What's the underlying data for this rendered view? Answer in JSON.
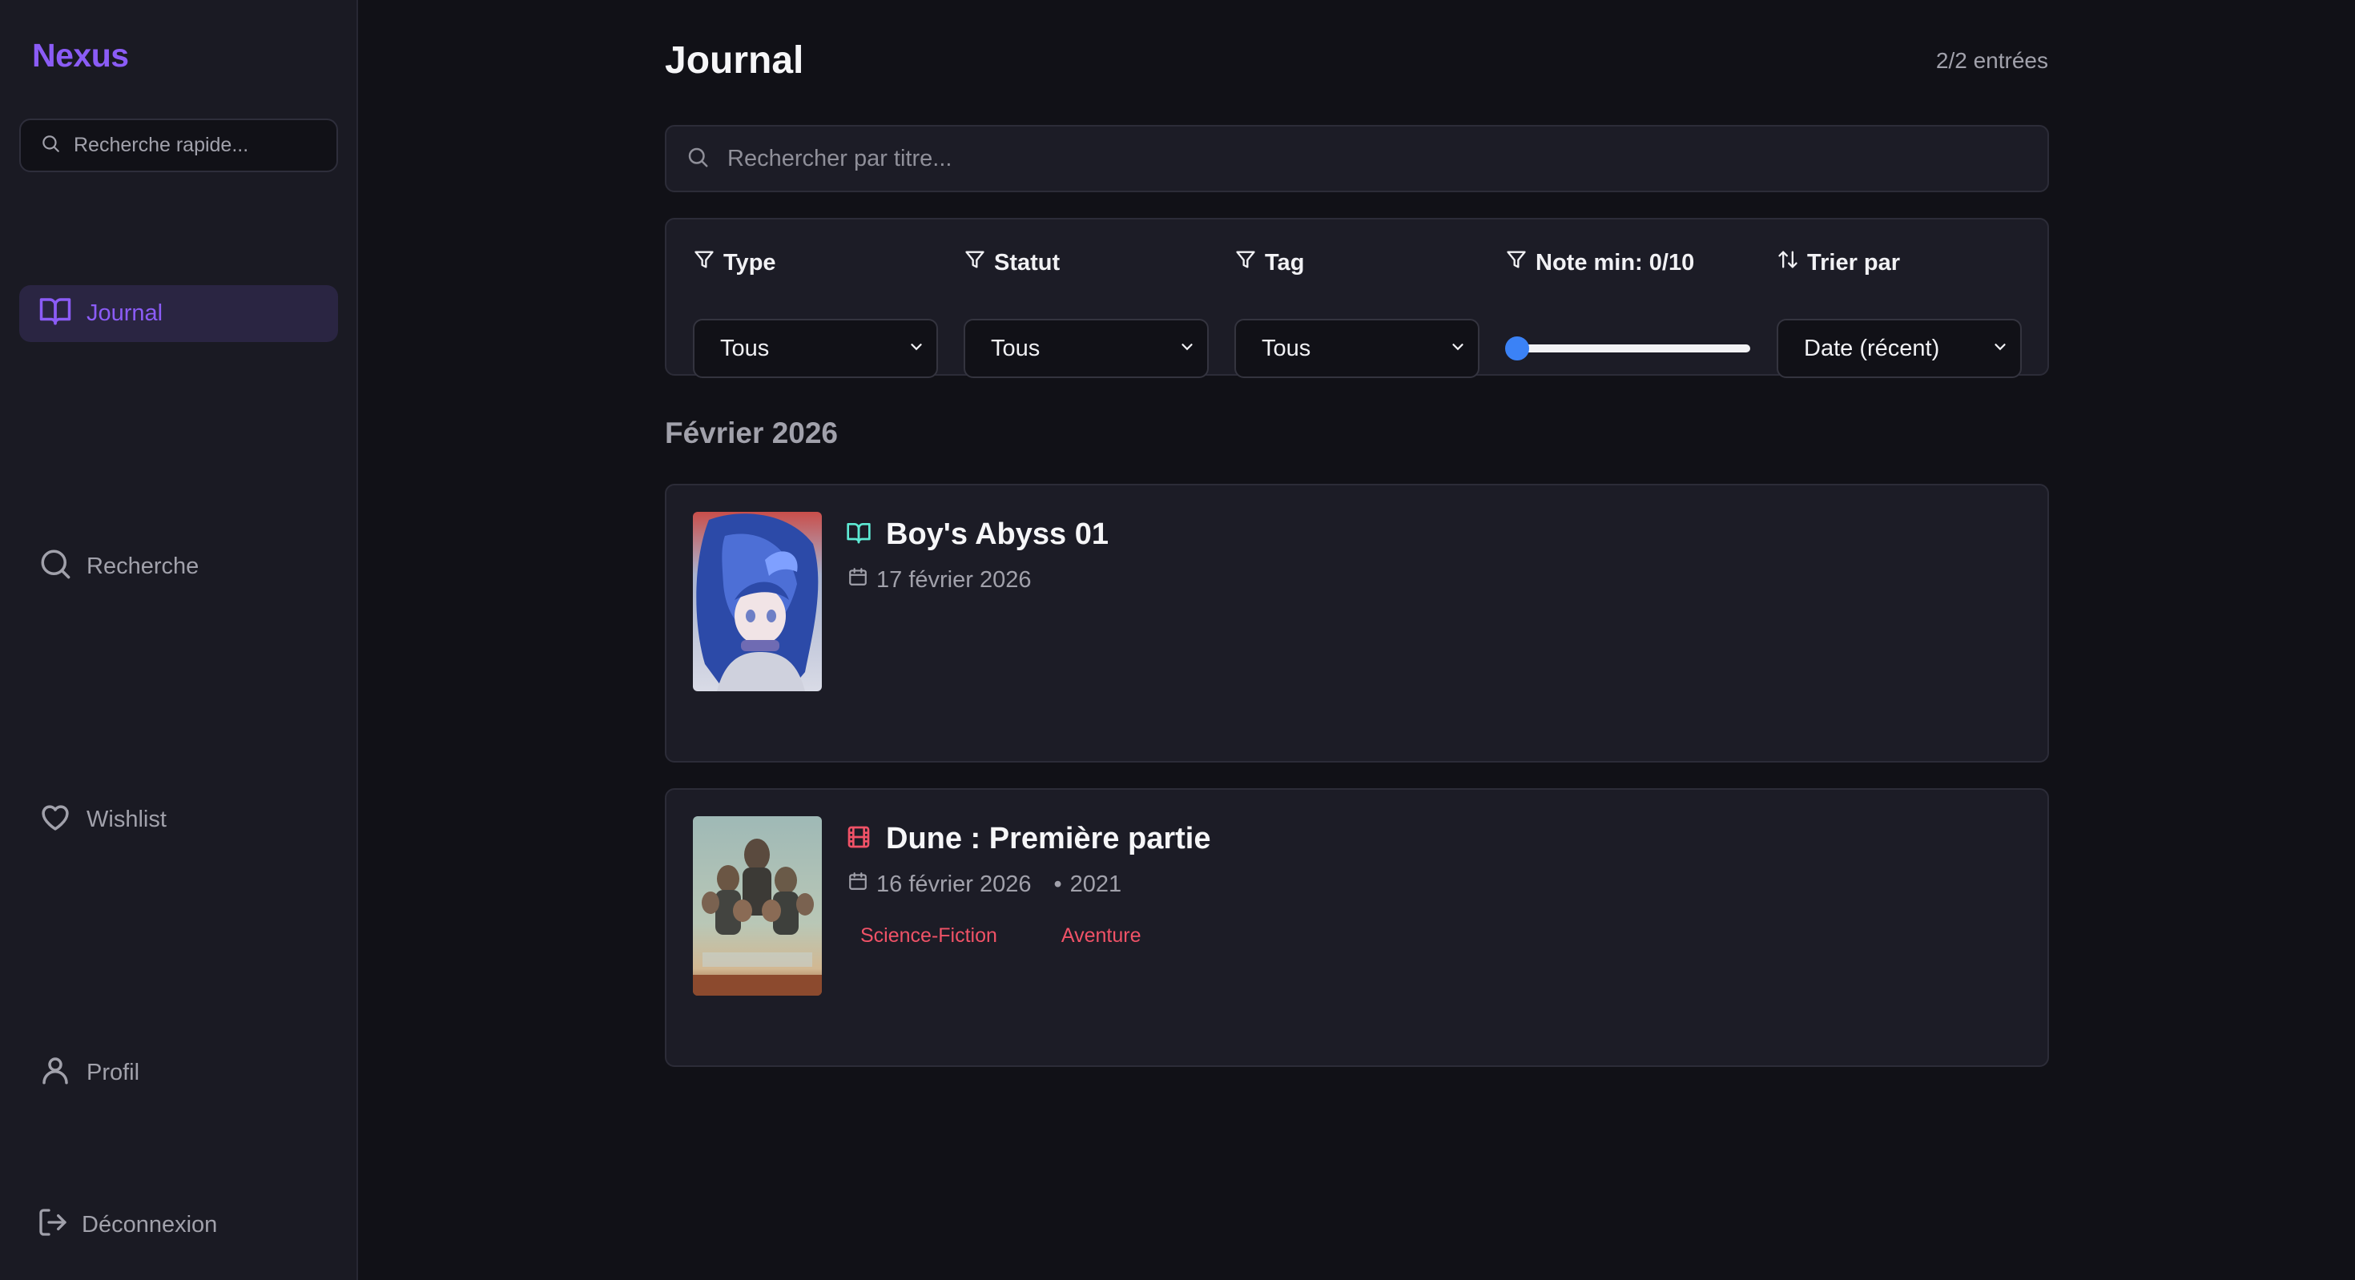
{
  "sidebar": {
    "brand": "Nexus",
    "quick_search_placeholder": "Recherche rapide...",
    "items": [
      {
        "label": "Journal",
        "icon": "book-open-icon",
        "active": true
      },
      {
        "label": "Recherche",
        "icon": "search-icon"
      },
      {
        "label": "Wishlist",
        "icon": "heart-icon"
      },
      {
        "label": "Profil",
        "icon": "user-icon"
      }
    ],
    "logout_label": "Déconnexion"
  },
  "main": {
    "title": "Journal",
    "count": "2/2 entrées",
    "search_placeholder": "Rechercher par titre..."
  },
  "filters": {
    "type": {
      "label": "Type",
      "value": "Tous"
    },
    "status": {
      "label": "Statut",
      "value": "Tous"
    },
    "tag": {
      "label": "Tag",
      "value": "Tous"
    },
    "rating": {
      "label": "Note min: 0/10",
      "value": 0,
      "max": 10
    },
    "sort": {
      "label": "Trier par",
      "value": "Date (récent)"
    }
  },
  "groups": [
    {
      "month": "Février 2026",
      "entries": [
        {
          "title": "Boy's Abyss 01",
          "type_icon": "book-open-icon",
          "date": "17 février 2026",
          "year": "",
          "tags": []
        },
        {
          "title": "Dune : Première partie",
          "type_icon": "film-icon",
          "date": "16 février 2026",
          "year": "2021",
          "tags": [
            "Science-Fiction",
            "Aventure"
          ]
        }
      ]
    }
  ],
  "colors": {
    "accent": "#8b5cf6",
    "book_icon": "#5eead4",
    "film_icon": "#f05267",
    "tag": "#f05267",
    "slider_thumb": "#3b82f6"
  }
}
